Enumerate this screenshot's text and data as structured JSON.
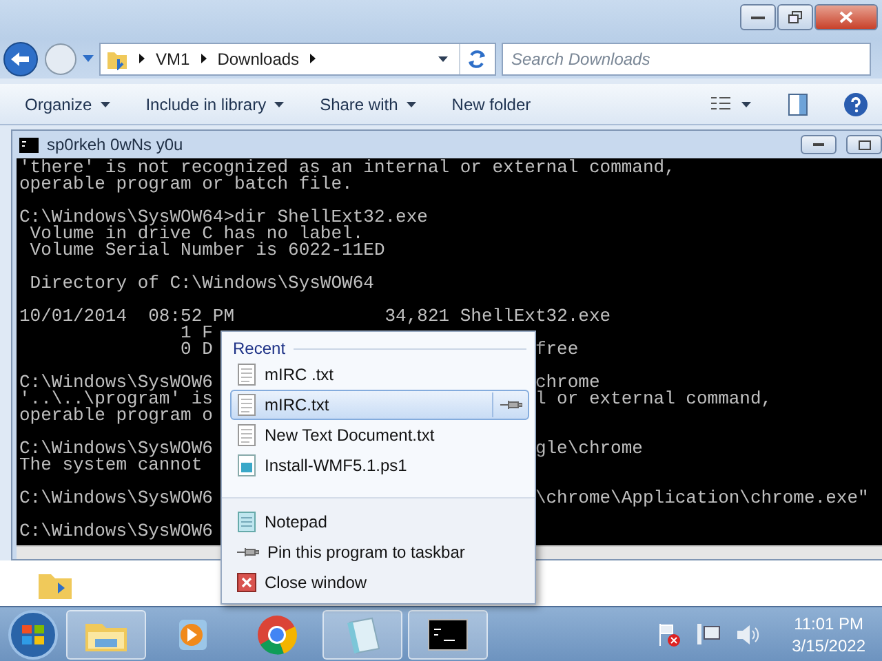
{
  "explorer": {
    "breadcrumb": [
      "VM1",
      "Downloads"
    ],
    "search": {
      "placeholder": "Search Downloads"
    },
    "toolbar": [
      {
        "label": "Organize",
        "dropdown": true
      },
      {
        "label": "Include in library",
        "dropdown": true
      },
      {
        "label": "Share with",
        "dropdown": true
      },
      {
        "label": "New folder",
        "dropdown": false
      }
    ]
  },
  "console": {
    "title": "sp0rkeh 0wNs y0u",
    "blocks": [
      [
        {
          "text": "'there' is not recognized as an internal or external command,"
        },
        {
          "text": "operable program or batch file."
        }
      ],
      [
        {
          "text": "C:\\Windows\\SysWOW64>dir ShellExt32.exe"
        },
        {
          "text": " Volume in drive C has no label."
        },
        {
          "text": " Volume Serial Number is 6022-11ED"
        }
      ],
      [
        {
          "text": " Directory of C:\\Windows\\SysWOW64"
        }
      ],
      [
        {
          "text": "10/01/2014  08:52 PM              34,821 ShellExt32.exe"
        },
        {
          "left": "               1 F"
        },
        {
          "left": "               0 D",
          "right": "free"
        }
      ],
      [
        {
          "left": "C:\\Windows\\SysWOW6",
          "right": "chrome"
        },
        {
          "left": "'..\\..\\program' is",
          "right": "l or external command,"
        },
        {
          "left": "operable program o"
        }
      ],
      [
        {
          "left": "C:\\Windows\\SysWOW6",
          "right": "gle\\chrome"
        },
        {
          "left": "The system cannot"
        }
      ],
      [
        {
          "left": "C:\\Windows\\SysWOW6",
          "right": "\\chrome\\Application\\chrome.exe\""
        }
      ],
      [
        {
          "left": "C:\\Windows\\SysWOW6"
        }
      ]
    ]
  },
  "jump_list": {
    "heading": "Recent",
    "recent": [
      {
        "label": "mIRC .txt",
        "kind": "text",
        "selected": false
      },
      {
        "label": "mIRC.txt",
        "kind": "text",
        "selected": true
      },
      {
        "label": "New Text Document.txt",
        "kind": "text",
        "selected": false
      },
      {
        "label": "Install-WMF5.1.ps1",
        "kind": "script",
        "selected": false
      }
    ],
    "tasks": [
      {
        "label": "Notepad",
        "kind": "notepad"
      },
      {
        "label": "Pin this program to taskbar",
        "kind": "pin"
      },
      {
        "label": "Close window",
        "kind": "close"
      }
    ]
  },
  "taskbar": {
    "apps": [
      {
        "kind": "explorer",
        "open": true
      },
      {
        "kind": "media",
        "open": false
      },
      {
        "kind": "chrome",
        "open": false
      },
      {
        "kind": "notepad",
        "open": true
      },
      {
        "kind": "console",
        "open": true
      }
    ],
    "clock": {
      "time": "11:01 PM",
      "date": "3/15/2022"
    }
  }
}
